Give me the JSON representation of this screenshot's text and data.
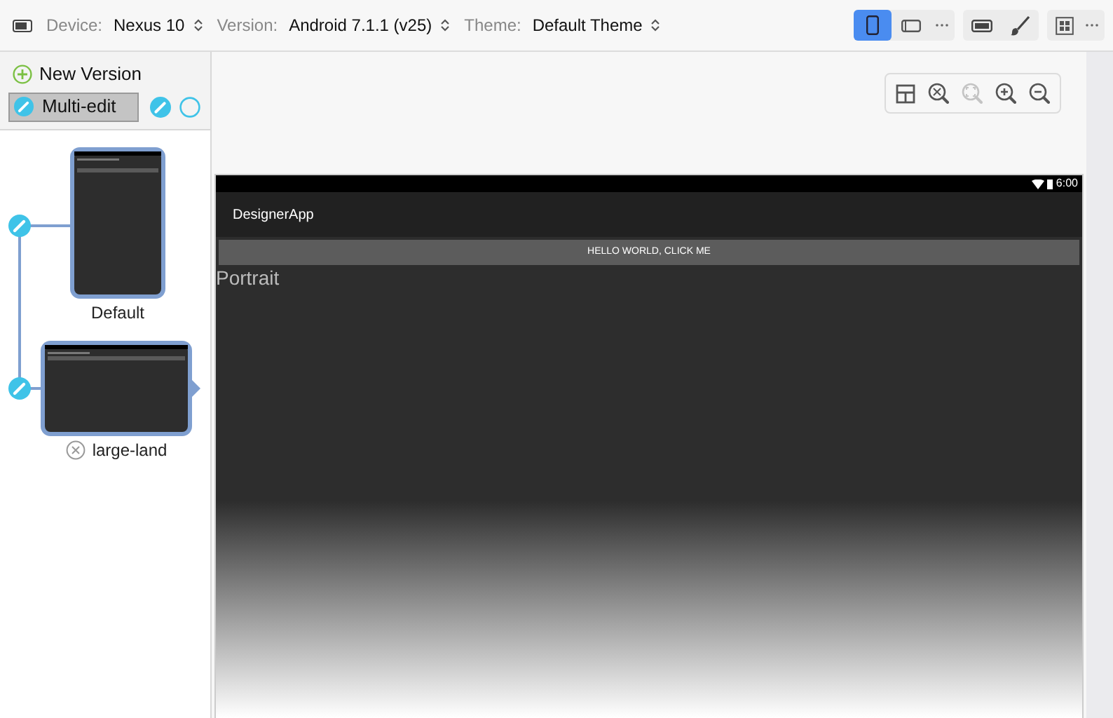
{
  "toolbar": {
    "fields": [
      {
        "label": "Device:",
        "value": "Nexus 10"
      },
      {
        "label": "Version:",
        "value": "Android 7.1.1 (v25)"
      },
      {
        "label": "Theme:",
        "value": "Default Theme"
      }
    ],
    "orientations": [
      {
        "kind": "portrait",
        "selected": true
      },
      {
        "kind": "landscape",
        "selected": false
      }
    ]
  },
  "sidebar": {
    "new_version": "New Version",
    "multi_edit": "Multi-edit",
    "versions": [
      {
        "label": "Default",
        "kind": "portrait",
        "removable": false,
        "selected": false
      },
      {
        "label": "large-land",
        "kind": "landscape",
        "removable": true,
        "selected": true
      }
    ]
  },
  "zoom_tools": [
    {
      "kind": "layout",
      "disabled": false
    },
    {
      "kind": "fit",
      "disabled": false
    },
    {
      "kind": "actual",
      "disabled": true
    },
    {
      "kind": "zoom-in",
      "disabled": false
    },
    {
      "kind": "zoom-out",
      "disabled": false
    }
  ],
  "preview": {
    "time": "6:00",
    "app_title": "DesignerApp",
    "button": "HELLO WORLD, CLICK ME",
    "text": "Portrait"
  }
}
